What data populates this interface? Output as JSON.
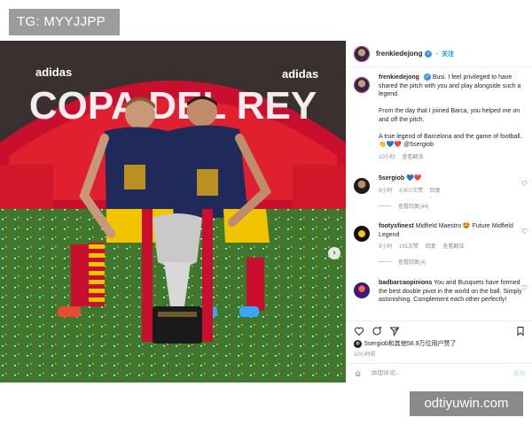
{
  "watermark_tag": "TG: MYYJJPP",
  "site_watermark": "odtiyuwin.com",
  "photo": {
    "banner_text": "COPA DEL REY",
    "sponsor": "adidas",
    "icons": {
      "carousel_next": "chevron-right-icon",
      "tagged_people": "person-icon"
    }
  },
  "post": {
    "author_handle": "frenkiedejong",
    "follow_label": "关注",
    "caption": {
      "handle": "frenkiedejong",
      "text_1": "Busi. I feel privileged to have shared the pitch with you and play alongside such a legend.",
      "text_2": "From the day that I joined Barca, you helped me on and off the pitch.",
      "text_3": "A true legend of Barcelona and the game of football. 👏💙❤️ @5sergiob",
      "time": "10小时",
      "translate": "查看翻译"
    },
    "comments": [
      {
        "handle": "5sergiob",
        "text": "💙❤️",
        "time": "9小时",
        "likes": "4,907次赞",
        "reply": "回复",
        "view_replies": "查看回复(44)"
      },
      {
        "handle": "footysfinest",
        "text": "Midfield Maestro 🤩 Future Midfield Legend",
        "time": "9小时",
        "likes": "191次赞",
        "reply": "回复",
        "translate": "查看翻译",
        "view_replies": "查看回复(4)"
      },
      {
        "handle": "badbarcaopinions",
        "text": "You and Busquets have formed the best double pivot in the world on the ball. Simply astonishing. Complement each other perfectly!",
        "time": "",
        "likes": "",
        "reply": ""
      }
    ],
    "liked_by": "5sergiob和其他58.9万位用户赞了",
    "post_time": "10小时前",
    "comment_placeholder": "添加评论...",
    "post_button": "发布",
    "icons": {
      "like": "heart-icon",
      "comment": "comment-icon",
      "share": "send-icon",
      "save": "bookmark-icon",
      "more": "more-icon",
      "emoji": "emoji-icon",
      "comment_like": "heart-icon",
      "verified": "verified-badge-icon"
    },
    "colors": {
      "link": "#0095f6",
      "verified": "#3897f0",
      "muted": "#8e8e8e"
    }
  }
}
